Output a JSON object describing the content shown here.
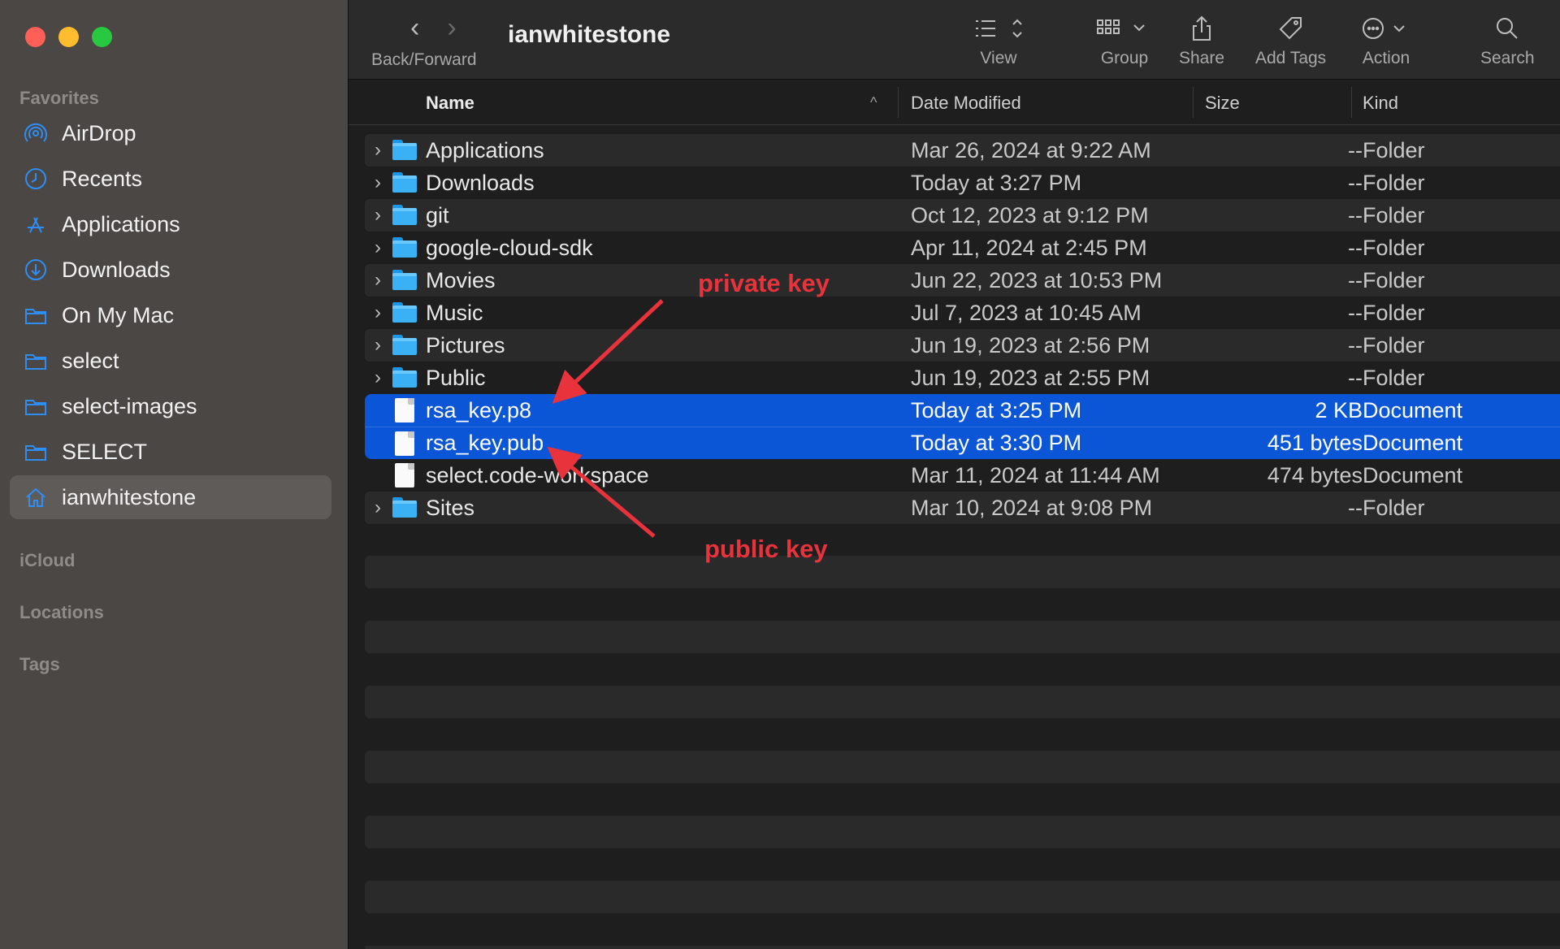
{
  "window": {
    "title": "ianwhitestone"
  },
  "sidebar": {
    "sections": {
      "favorites": "Favorites",
      "icloud": "iCloud",
      "locations": "Locations",
      "tags": "Tags"
    },
    "items": [
      {
        "label": "AirDrop",
        "icon": "airdrop-icon"
      },
      {
        "label": "Recents",
        "icon": "clock-icon"
      },
      {
        "label": "Applications",
        "icon": "applications-icon"
      },
      {
        "label": "Downloads",
        "icon": "download-icon"
      },
      {
        "label": "On My Mac",
        "icon": "folder-icon"
      },
      {
        "label": "select",
        "icon": "folder-icon"
      },
      {
        "label": "select-images",
        "icon": "folder-icon"
      },
      {
        "label": "SELECT",
        "icon": "folder-icon"
      },
      {
        "label": "ianwhitestone",
        "icon": "home-icon",
        "active": true
      }
    ]
  },
  "toolbar": {
    "back_forward_label": "Back/Forward",
    "view_label": "View",
    "group_label": "Group",
    "share_label": "Share",
    "add_tags_label": "Add Tags",
    "action_label": "Action",
    "search_label": "Search"
  },
  "columns": {
    "name": "Name",
    "date_modified": "Date Modified",
    "size": "Size",
    "kind": "Kind"
  },
  "files": [
    {
      "name": "Applications",
      "date": "Mar 26, 2024 at 9:22 AM",
      "size": "--",
      "kind": "Folder",
      "type": "folder"
    },
    {
      "name": "Downloads",
      "date": "Today at 3:27 PM",
      "size": "--",
      "kind": "Folder",
      "type": "folder"
    },
    {
      "name": "git",
      "date": "Oct 12, 2023 at 9:12 PM",
      "size": "--",
      "kind": "Folder",
      "type": "folder"
    },
    {
      "name": "google-cloud-sdk",
      "date": "Apr 11, 2024 at 2:45 PM",
      "size": "--",
      "kind": "Folder",
      "type": "folder"
    },
    {
      "name": "Movies",
      "date": "Jun 22, 2023 at 10:53 PM",
      "size": "--",
      "kind": "Folder",
      "type": "folder"
    },
    {
      "name": "Music",
      "date": "Jul 7, 2023 at 10:45 AM",
      "size": "--",
      "kind": "Folder",
      "type": "folder"
    },
    {
      "name": "Pictures",
      "date": "Jun 19, 2023 at 2:56 PM",
      "size": "--",
      "kind": "Folder",
      "type": "folder"
    },
    {
      "name": "Public",
      "date": "Jun 19, 2023 at 2:55 PM",
      "size": "--",
      "kind": "Folder",
      "type": "folder"
    },
    {
      "name": "rsa_key.p8",
      "date": "Today at 3:25 PM",
      "size": "2 KB",
      "kind": "Document",
      "type": "document",
      "selected": true
    },
    {
      "name": "rsa_key.pub",
      "date": "Today at 3:30 PM",
      "size": "451 bytes",
      "kind": "Document",
      "type": "document",
      "selected": true
    },
    {
      "name": "select.code-workspace",
      "date": "Mar 11, 2024 at 11:44 AM",
      "size": "474 bytes",
      "kind": "Document",
      "type": "document"
    },
    {
      "name": "Sites",
      "date": "Mar 10, 2024 at 9:08 PM",
      "size": "--",
      "kind": "Folder",
      "type": "folder"
    }
  ],
  "annotations": {
    "private_key": "private key",
    "public_key": "public key",
    "color": "#e8323c"
  },
  "colors": {
    "selection": "#0a56d6",
    "accent": "#2f8ef5",
    "folder": "#3ab0f5"
  }
}
